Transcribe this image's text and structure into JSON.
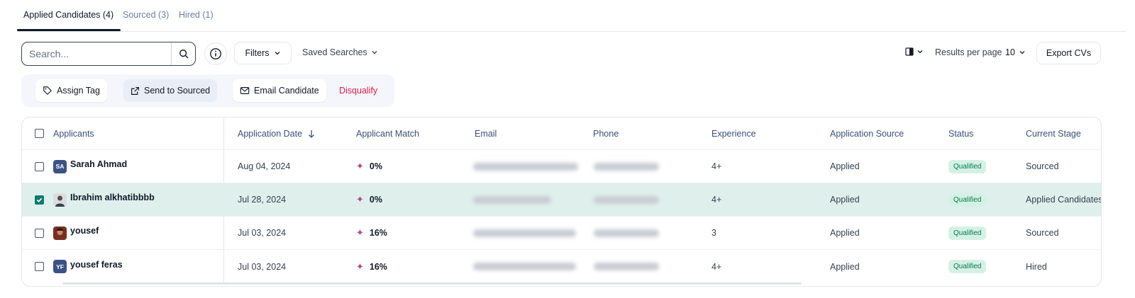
{
  "tabs": [
    {
      "label": "Applied Candidates (4)",
      "active": true
    },
    {
      "label": "Sourced (3)",
      "active": false
    },
    {
      "label": "Hired (1)",
      "active": false
    }
  ],
  "toolbar": {
    "search_placeholder": "Search...",
    "search_value": "",
    "filters_label": "Filters",
    "saved_searches_label": "Saved Searches",
    "results_per_page_label": "Results per page",
    "results_per_page_value": "10",
    "export_label": "Export CVs"
  },
  "actions": {
    "assign_tag": "Assign Tag",
    "send_to_sourced": "Send to Sourced",
    "email_candidate": "Email Candidate",
    "disqualify": "Disqualify"
  },
  "table": {
    "headers": {
      "applicants": "Applicants",
      "application_date": "Application Date",
      "applicant_match": "Applicant Match",
      "email": "Email",
      "phone": "Phone",
      "experience": "Experience",
      "application_source": "Application Source",
      "status": "Status",
      "current_stage": "Current Stage"
    },
    "rows": [
      {
        "name": "Sarah Ahmad",
        "initials": "SA",
        "date": "Aug 04, 2024",
        "match": "0%",
        "experience": "4+",
        "source": "Applied",
        "status": "Qualified",
        "stage": "Sourced"
      },
      {
        "name": "Ibrahim alkhatibbbb",
        "initials": "",
        "date": "Jul 28, 2024",
        "match": "0%",
        "experience": "4+",
        "source": "Applied",
        "status": "Qualified",
        "stage": "Applied Candidates"
      },
      {
        "name": "yousef",
        "initials": "",
        "date": "Jul 03, 2024",
        "match": "16%",
        "experience": "3",
        "source": "Applied",
        "status": "Qualified",
        "stage": "Sourced"
      },
      {
        "name": "yousef feras",
        "initials": "YF",
        "date": "Jul 03, 2024",
        "match": "16%",
        "experience": "4+",
        "source": "Applied",
        "status": "Qualified",
        "stage": "Hired"
      }
    ]
  },
  "colors": {
    "accent": "#0e7c6b",
    "selected_row": "#dff0ec",
    "qualified_badge_bg": "#d5f1e5",
    "qualified_badge_text": "#067a4f",
    "danger": "#e11d48",
    "avatar_initials_bg": "#3b5285"
  }
}
